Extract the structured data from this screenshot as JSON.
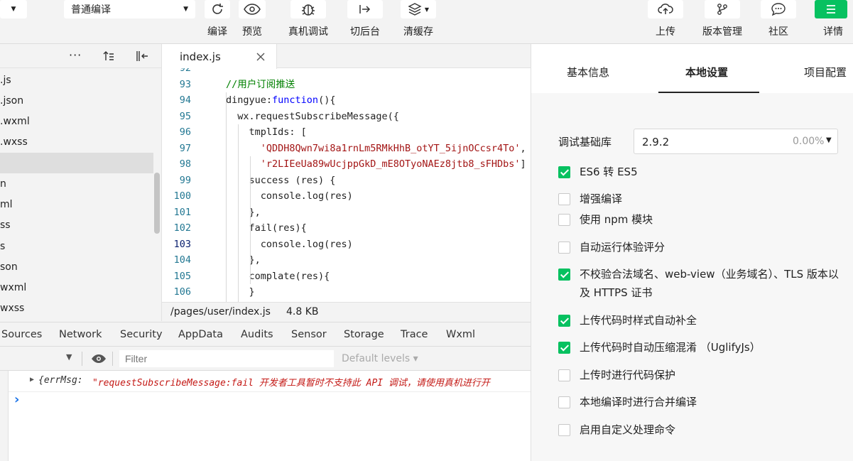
{
  "toolbar": {
    "compile_mode": "普通编译",
    "buttons": {
      "compile": "编译",
      "preview": "预览",
      "real_debug": "真机调试",
      "background": "切后台",
      "clear_cache": "清缓存",
      "upload": "上传",
      "version": "版本管理",
      "community": "社区",
      "details": "详情"
    }
  },
  "file_tree": {
    "items": [
      ".js",
      ".json",
      ".wxml",
      ".wxss",
      "",
      "n",
      "ml",
      "ss",
      "s",
      "son",
      "wxml",
      "wxss"
    ]
  },
  "editor": {
    "tab_label": "index.js",
    "lines": [
      {
        "n": "92",
        "text": ""
      },
      {
        "n": "93",
        "text": "//用户订阅推送"
      },
      {
        "n": "94",
        "text": "dingyue:function(){"
      },
      {
        "n": "95",
        "text": "  wx.requestSubscribeMessage({"
      },
      {
        "n": "96",
        "text": "    tmplIds: ["
      },
      {
        "n": "97",
        "text": "      'QDDH8Qwn7wi8a1rnLm5RMkHhB_otYT_5ijnOCcsr4To',"
      },
      {
        "n": "98",
        "text": "      'r2LIEeUa89wUcjppGkD_mE8OTyoNAEz8jtb8_sFHDbs']"
      },
      {
        "n": "99",
        "text": "    success (res) {"
      },
      {
        "n": "100",
        "text": "      console.log(res)"
      },
      {
        "n": "101",
        "text": "    },"
      },
      {
        "n": "102",
        "text": "    fail(res){"
      },
      {
        "n": "103",
        "text": "      console.log(res)"
      },
      {
        "n": "104",
        "text": "    },"
      },
      {
        "n": "105",
        "text": "    complate(res){"
      },
      {
        "n": "106",
        "text": "    }"
      }
    ],
    "status_path": "/pages/user/index.js",
    "status_size": "4.8 KB"
  },
  "devtools": {
    "tabs": [
      "Sources",
      "Network",
      "Security",
      "AppData",
      "Audits",
      "Sensor",
      "Storage",
      "Trace",
      "Wxml"
    ],
    "filter_placeholder": "Filter",
    "levels": "Default levels ▾",
    "console_prefix": "{errMsg: ",
    "console_message": "\"requestSubscribeMessage:fail 开发者工具暂时不支持此 API 调试，请使用真机进行开",
    "prompt": "›"
  },
  "settings": {
    "tabs": [
      "基本信息",
      "本地设置",
      "项目配置"
    ],
    "lib_label": "调试基础库",
    "lib_version": "2.9.2",
    "lib_percent": "0.00%",
    "options": [
      {
        "label": "ES6 转 ES5",
        "checked": true
      },
      {
        "label": "增强编译",
        "checked": false
      },
      {
        "label": "使用 npm 模块",
        "checked": false
      },
      {
        "label": "自动运行体验评分",
        "checked": false
      },
      {
        "label": "不校验合法域名、web-view（业务域名）、TLS 版本以及 HTTPS 证书",
        "checked": true
      },
      {
        "label": "上传代码时样式自动补全",
        "checked": true
      },
      {
        "label": "上传代码时自动压缩混淆 （UglifyJs）",
        "checked": true
      },
      {
        "label": "上传时进行代码保护",
        "checked": false
      },
      {
        "label": "本地编译时进行合并编译",
        "checked": false
      },
      {
        "label": "启用自定义处理命令",
        "checked": false
      }
    ]
  },
  "colors": {
    "accent": "#07c160",
    "code_comment": "#008000",
    "code_string": "#a31515",
    "code_keyword": "#0000ff",
    "line_number": "#237893"
  }
}
